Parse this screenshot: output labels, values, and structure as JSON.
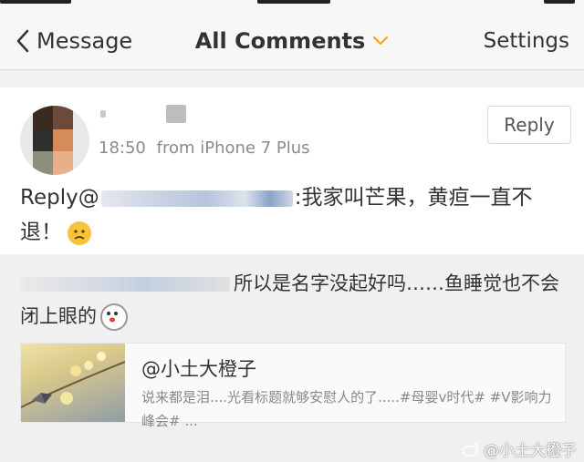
{
  "nav": {
    "back_label": "Message",
    "title": "All Comments",
    "settings_label": "Settings"
  },
  "comment": {
    "time": "18:50",
    "source": "from iPhone 7 Plus",
    "reply_button": "Reply",
    "reply_prefix": "Reply@",
    "reply_text": ":我家叫芒果，黄疸一直不退！"
  },
  "original": {
    "text": "所以是名字没起好吗……鱼睡觉也不会闭上眼的"
  },
  "link_card": {
    "title": "@小土大橙子",
    "description": "说来都是泪....光看标题就够安慰人的了.....#母婴v时代# #V影响力峰会# ..."
  },
  "watermark": {
    "text": "@小土大橙子"
  },
  "colors": {
    "accent": "#f5a623",
    "nav_bg": "#f7f7f7",
    "card_bg": "#ffffff",
    "muted": "#8a8a8a"
  }
}
